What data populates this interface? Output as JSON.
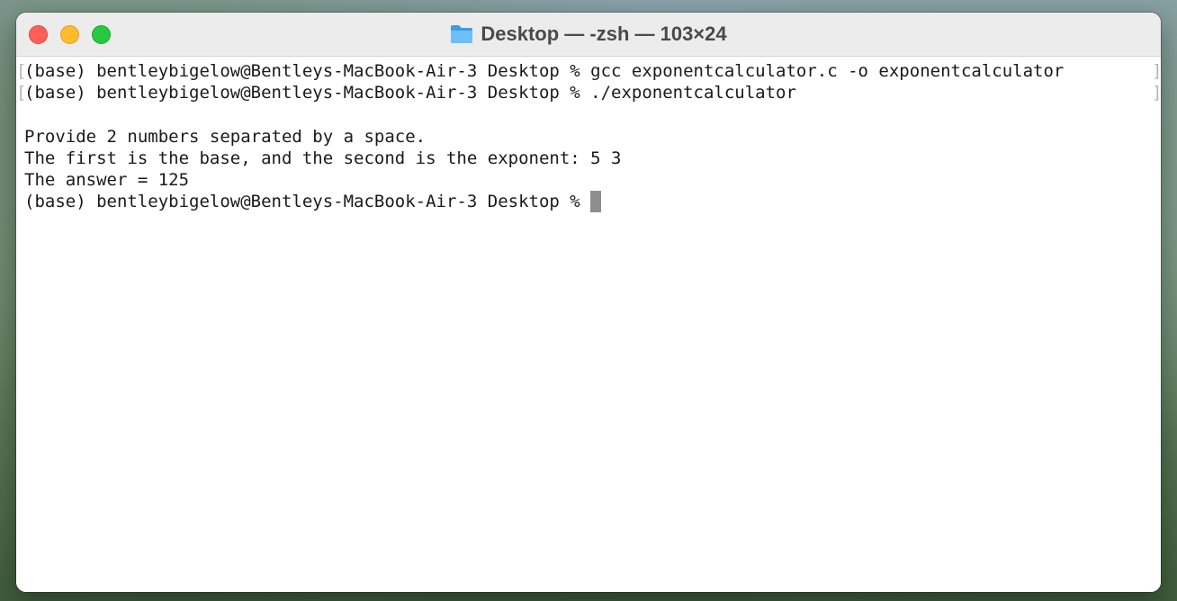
{
  "window": {
    "title": "Desktop — -zsh — 103×24",
    "title_icon": "folder-icon"
  },
  "traffic_lights": {
    "close": "#ff5f57",
    "minimize": "#febc2e",
    "zoom": "#28c840"
  },
  "terminal": {
    "lines": [
      "(base) bentleybigelow@Bentleys-MacBook-Air-3 Desktop % gcc exponentcalculator.c -o exponentcalculator",
      "(base) bentleybigelow@Bentleys-MacBook-Air-3 Desktop % ./exponentcalculator",
      "",
      "Provide 2 numbers separated by a space.",
      "The first is the base, and the second is the exponent: 5 3",
      "The answer = 125",
      "(base) bentleybigelow@Bentleys-MacBook-Air-3 Desktop % "
    ],
    "mark_left": "[",
    "mark_right": "]",
    "cursor_color": "#8e8e8e"
  }
}
